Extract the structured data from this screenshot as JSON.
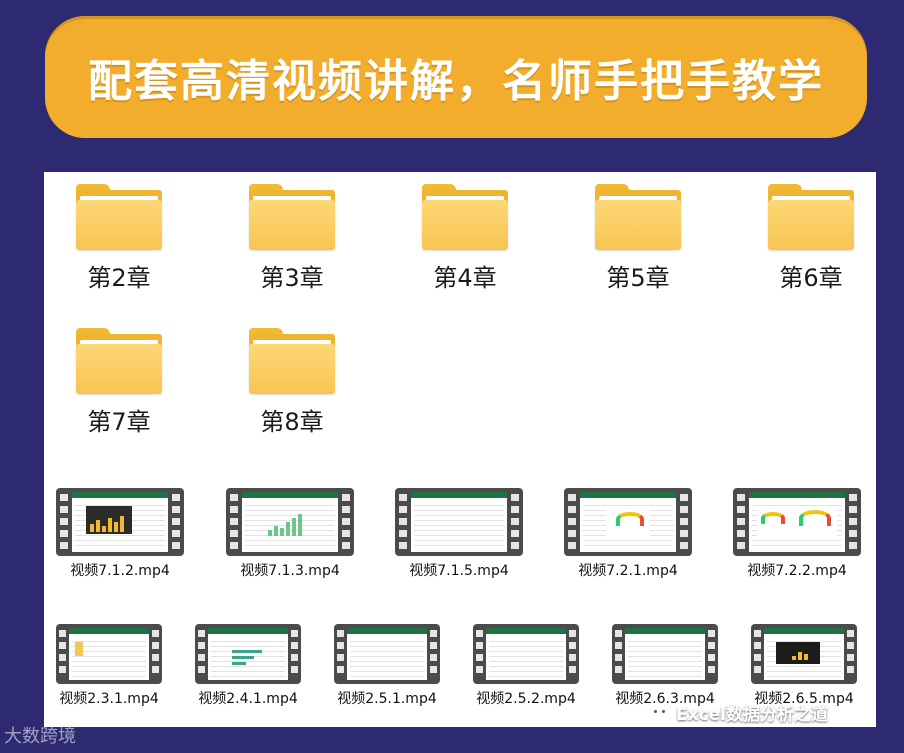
{
  "banner": {
    "title": "配套高清视频讲解，名师手把手教学"
  },
  "folders": [
    {
      "label": "第2章"
    },
    {
      "label": "第3章"
    },
    {
      "label": "第4章"
    },
    {
      "label": "第5章"
    },
    {
      "label": "第6章"
    },
    {
      "label": "第7章"
    },
    {
      "label": "第8章"
    }
  ],
  "videos_row1": [
    {
      "label": "视频7.1.2.mp4",
      "thumb": "dark-bar-chart"
    },
    {
      "label": "视频7.1.3.mp4",
      "thumb": "green-bar-chart"
    },
    {
      "label": "视频7.1.5.mp4",
      "thumb": "spreadsheet"
    },
    {
      "label": "视频7.2.1.mp4",
      "thumb": "gauge"
    },
    {
      "label": "视频7.2.2.mp4",
      "thumb": "double-gauge"
    }
  ],
  "videos_row2": [
    {
      "label": "视频2.3.1.mp4",
      "thumb": "spreadsheet"
    },
    {
      "label": "视频2.4.1.mp4",
      "thumb": "teal-bar-chart"
    },
    {
      "label": "视频2.5.1.mp4",
      "thumb": "spreadsheet"
    },
    {
      "label": "视频2.5.2.mp4",
      "thumb": "spreadsheet"
    },
    {
      "label": "视频2.6.3.mp4",
      "thumb": "spreadsheet"
    },
    {
      "label": "视频2.6.5.mp4",
      "thumb": "dark-chart"
    }
  ],
  "watermark": {
    "text": "Excel数据分析之道",
    "icon": "wechat-icon"
  },
  "logo": {
    "text": "大数跨境"
  },
  "colors": {
    "background": "#2e2a72",
    "banner": "#f1ad2b",
    "folder": "#f7c550"
  }
}
